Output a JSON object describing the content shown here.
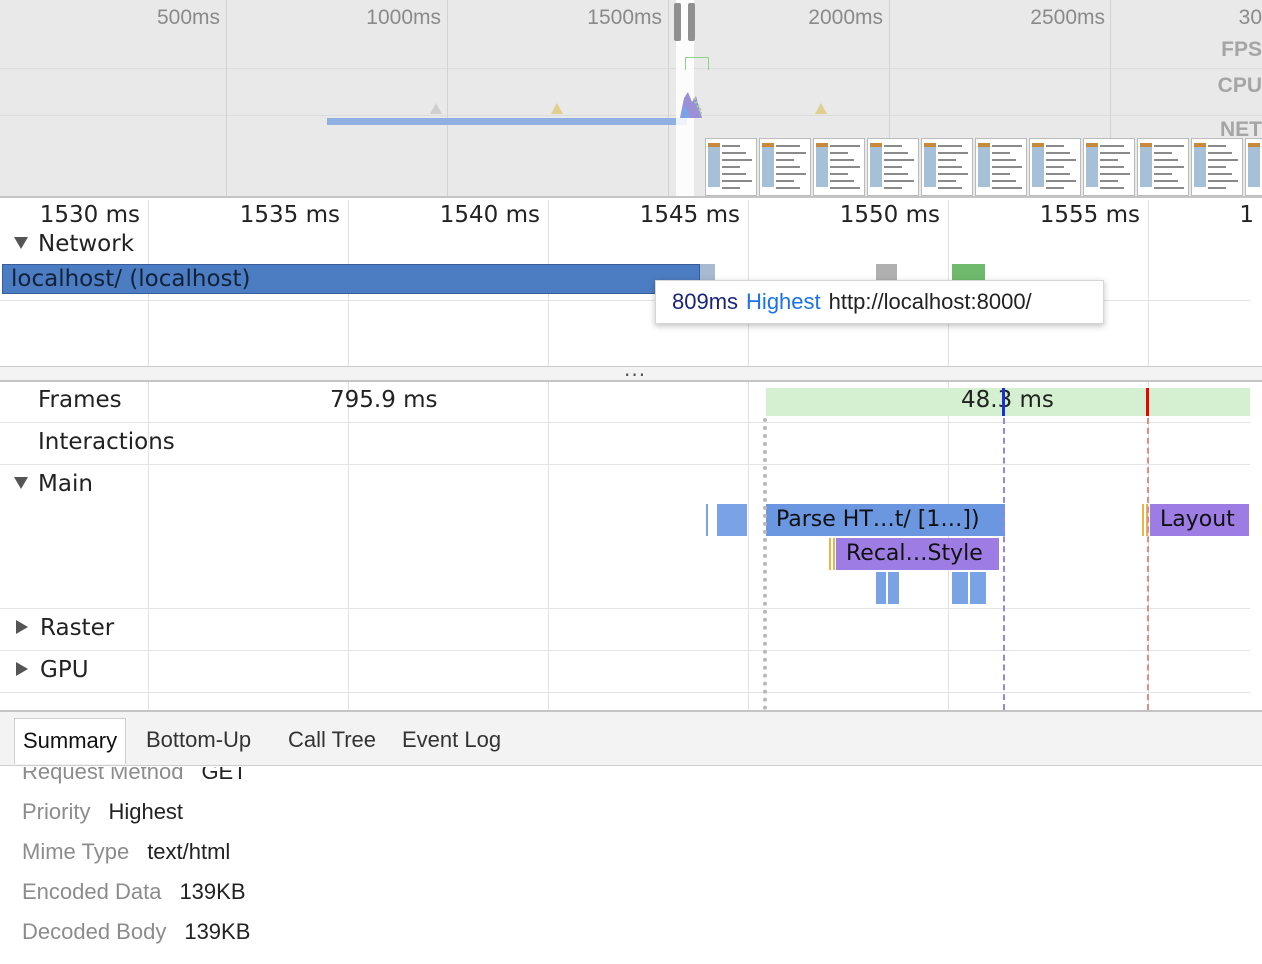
{
  "overview": {
    "ticks": [
      "500ms",
      "1000ms",
      "1500ms",
      "2000ms",
      "2500ms",
      "30"
    ],
    "side_labels": {
      "fps": "FPS",
      "cpu": "CPU",
      "net": "NET"
    }
  },
  "ruler": [
    "1530 ms",
    "1535 ms",
    "1540 ms",
    "1545 ms",
    "1550 ms",
    "1555 ms",
    "1"
  ],
  "network": {
    "label": "Network",
    "request_label": "localhost/ (localhost)",
    "tooltip": {
      "time": "809ms",
      "priority": "Highest",
      "url": "http://localhost:8000/"
    }
  },
  "splitter": "...",
  "tracks": {
    "frames": "Frames",
    "interactions": "Interactions",
    "main": "Main",
    "raster": "Raster",
    "gpu": "GPU"
  },
  "frames": {
    "first": "795.9 ms",
    "second": "48.3 ms"
  },
  "events": {
    "parse_html": "Parse HT…t/ [1…])",
    "recalc_style": "Recal…Style",
    "layout": "Layout"
  },
  "tabs": [
    "Summary",
    "Bottom-Up",
    "Call Tree",
    "Event Log"
  ],
  "details": [
    {
      "key": "Request Method",
      "value": "GET"
    },
    {
      "key": "Priority",
      "value": "Highest"
    },
    {
      "key": "Mime Type",
      "value": "text/html"
    },
    {
      "key": "Encoded Data",
      "value": "139KB"
    },
    {
      "key": "Decoded Body",
      "value": "139KB"
    }
  ],
  "colors": {
    "network_request": "#4c7cc1",
    "scripting": "#7aa3e5",
    "rendering": "#9d7ce3",
    "frame": "#d4f0d1",
    "priority_link": "#1a73e8"
  }
}
